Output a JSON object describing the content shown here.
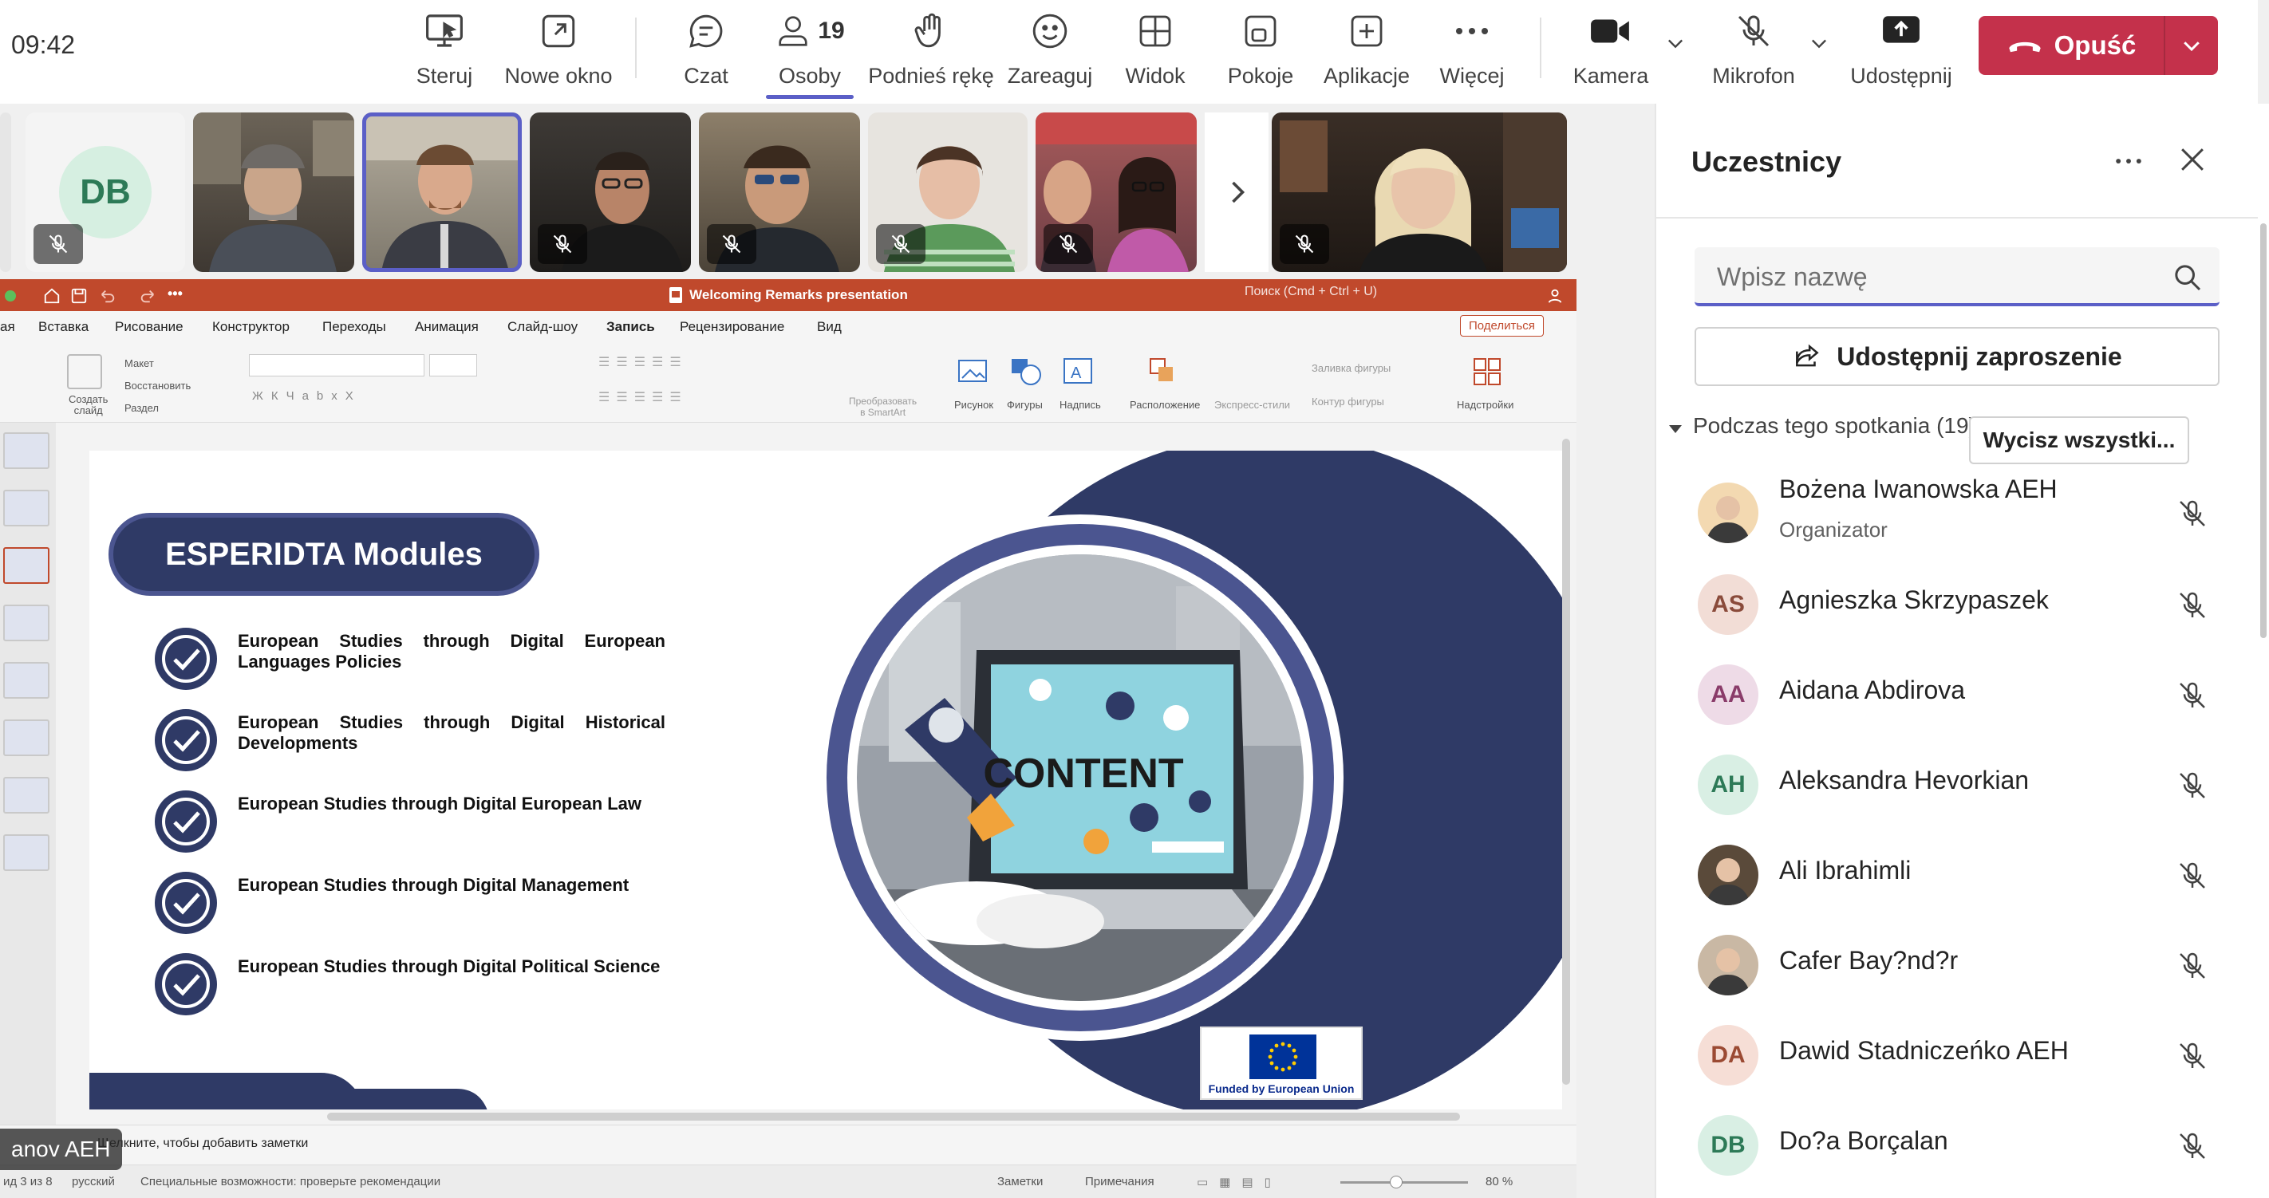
{
  "clock": "09:42",
  "toolbar": {
    "steruj": "Steruj",
    "nowe_okno": "Nowe okno",
    "czat": "Czat",
    "osoby": "Osoby",
    "osoby_count": "19",
    "podnies": "Podnieś rękę",
    "zareaguj": "Zareaguj",
    "widok": "Widok",
    "pokoje": "Pokoje",
    "aplikacje": "Aplikacje",
    "wiecej": "Więcej",
    "kamera": "Kamera",
    "mikrofon": "Mikrofon",
    "udostepnij": "Udostępnij",
    "opusc": "Opuść"
  },
  "strip": {
    "first_initials": "DB"
  },
  "ppt": {
    "title": "Welcoming Remarks presentation",
    "search": "Поиск (Cmd + Ctrl + U)",
    "share": "Поделиться",
    "menu": [
      "Вставка",
      "Рисование",
      "Конструктор",
      "Переходы",
      "Анимация",
      "Слайд-шоу",
      "Запись",
      "Рецензирование",
      "Вид"
    ],
    "menu_first_partial": "ая",
    "ribbon": {
      "maket": "Макет",
      "vosstanovit": "Восстановить",
      "razdel": "Раздел",
      "sozdat": "Создать",
      "slayd": "слайд",
      "preobrazovat": "Преобразовать",
      "smartart": "в SmartArt",
      "risunok": "Рисунок",
      "figury": "Фигуры",
      "nadpis": "Надпись",
      "raspolozhenie": "Расположение",
      "ekspress": "Экспресс-стили",
      "zalivka": "Заливка фигуры",
      "kontur": "Контур фигуры",
      "nadstroyki": "Надстройки"
    },
    "notes": "Щелкните, чтобы добавить заметки",
    "status": {
      "slide": "ид 3 из 8",
      "lang": "русский",
      "access": "Специальные возможности: проверьте рекомендации",
      "zametki": "Заметки",
      "primechaniya": "Примечания",
      "zoom": "80 %"
    },
    "name_badge": "anov AEH"
  },
  "slide": {
    "heading": "ESPERIDTA Modules",
    "items": [
      "European Studies through Digital European Languages Policies",
      "European Studies through Digital Historical Developments",
      "European Studies through Digital European Law",
      "European Studies through Digital Management",
      "European Studies through Digital Political Science"
    ],
    "content_word": "CONTENT",
    "eu_text": "Funded by European Union"
  },
  "panel": {
    "title": "Uczestnicy",
    "search_placeholder": "Wpisz nazwę",
    "invite": "Udostępnij zaproszenie",
    "section": "Podczas tego spotkania (19)",
    "mute_all": "Wycisz wszystki...",
    "people": [
      {
        "name": "Bożena Iwanowska AEH",
        "role": "Organizator",
        "initials": "",
        "color": "#f3d9b1",
        "photo": true
      },
      {
        "name": "Agnieszka Skrzypaszek",
        "role": "",
        "initials": "AS",
        "color": "#f2ddd6",
        "text": "#8a4b3b"
      },
      {
        "name": "Aidana Abdirova",
        "role": "",
        "initials": "AA",
        "color": "#eedbe7",
        "text": "#8a3c6a"
      },
      {
        "name": "Aleksandra Hevorkian",
        "role": "",
        "initials": "AH",
        "color": "#d9efe4",
        "text": "#2d7a57"
      },
      {
        "name": "Ali Ibrahimli",
        "role": "",
        "initials": "",
        "color": "#5a4a3a",
        "photo": true
      },
      {
        "name": "Cafer Bay?nd?r",
        "role": "",
        "initials": "",
        "color": "#c9b8a4",
        "photo": true
      },
      {
        "name": "Dawid Stadniczeńko AEH",
        "role": "",
        "initials": "DA",
        "color": "#f6ded6",
        "text": "#9b4a33"
      },
      {
        "name": "Do?a Borçalan",
        "role": "",
        "initials": "DB",
        "color": "#d9efe4",
        "text": "#2d7a57"
      }
    ]
  },
  "colors": {
    "accent": "#5b5fc7",
    "leave": "#c4314b",
    "ppt": "#c0492c",
    "slide_navy": "#2f3a66"
  }
}
